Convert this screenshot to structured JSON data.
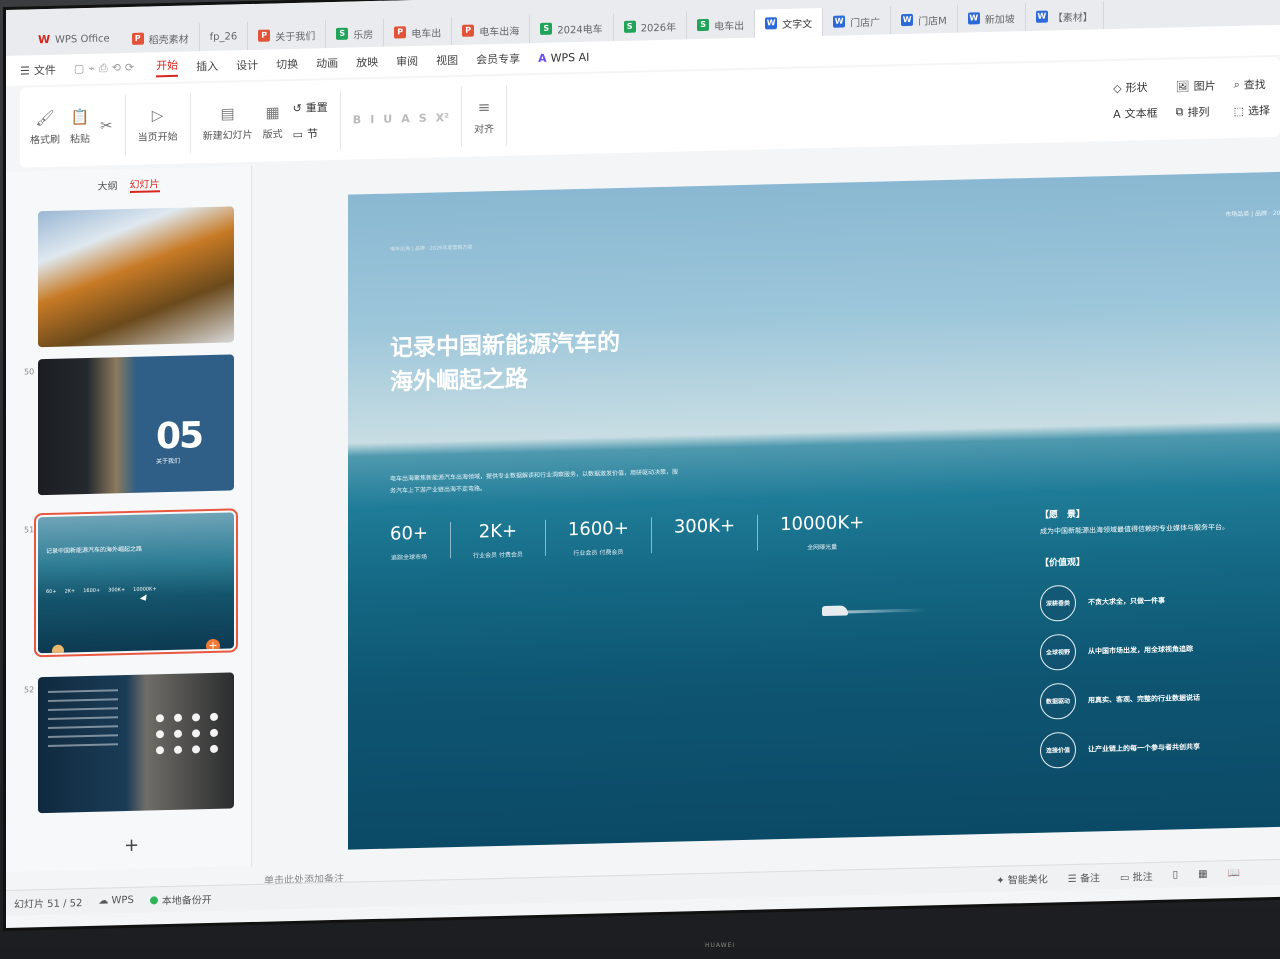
{
  "tabbar": {
    "home": "WPS Office",
    "tabs": [
      {
        "label": "稻壳素材",
        "type": "p"
      },
      {
        "label": "fp_26",
        "type": "none"
      },
      {
        "label": "关于我们",
        "type": "p"
      },
      {
        "label": "乐房",
        "type": "s"
      },
      {
        "label": "电车出",
        "type": "p"
      },
      {
        "label": "电车出海",
        "type": "p"
      },
      {
        "label": "2024电车",
        "type": "s"
      },
      {
        "label": "2026年",
        "type": "s"
      },
      {
        "label": "电车出",
        "type": "s"
      },
      {
        "label": "文字文",
        "type": "w"
      },
      {
        "label": "门店广",
        "type": "w"
      },
      {
        "label": "门店M",
        "type": "w"
      },
      {
        "label": "新加坡",
        "type": "w"
      },
      {
        "label": "【素材】",
        "type": "w"
      }
    ]
  },
  "menubar": {
    "file": "文件",
    "items": [
      "开始",
      "插入",
      "设计",
      "切换",
      "动画",
      "放映",
      "审阅",
      "视图",
      "会员专享"
    ],
    "ai": "WPS AI"
  },
  "ribbon": {
    "format_painter": "格式刷",
    "paste": "粘贴",
    "play_from_current": "当页开始",
    "new_slide": "新建幻灯片",
    "layout": "版式",
    "reset": "重置",
    "section": "节",
    "align": "对齐",
    "shape": "形状",
    "picture": "图片",
    "textbox": "文本框",
    "arrange": "排列",
    "find": "查找",
    "select": "选择"
  },
  "leftpanel": {
    "tab_outline": "大纲",
    "tab_slides": "幻灯片",
    "thumb_numbers": [
      "50",
      "51",
      "52"
    ],
    "thumb2_big": "05",
    "thumb2_caption": "关于我们",
    "thumb3_title": "记录中国新能源汽车的海外崛起之路",
    "thumb3_stats": [
      "60+",
      "2K+",
      "1600+",
      "300K+",
      "10000K+"
    ]
  },
  "slide": {
    "breadcrumb": "电车出海 | 品牌 · 2026年度营销方案",
    "top_right": "市场品类 | 品牌 · 2026",
    "title_line1": "记录中国新能源汽车的",
    "title_line2": "海外崛起之路",
    "description": "电车出海聚焦新能源汽车出海领域，提供专业数据解读和行业洞察服务，以数据激发价值，用研驱动决策，服务汽车上下游产业链出海不走弯路。",
    "stats": [
      {
        "value": "60+",
        "label": "追踪全球市场"
      },
      {
        "value": "2K+",
        "label": "行业会员 付费会员"
      },
      {
        "value": "1600+",
        "label": "行业会员 付费会员"
      },
      {
        "value": "300K+",
        "label": ""
      },
      {
        "value": "10000K+",
        "label": "全网曝光量"
      }
    ],
    "vision_heading": "【愿　景】",
    "vision_text": "成为中国新能源出海领域最值得信赖的专业媒体与服务平台。",
    "values_heading": "【价值观】",
    "values": [
      {
        "badge": "深耕垂类",
        "text": "不贪大求全，只做一件事"
      },
      {
        "badge": "全球视野",
        "text": "从中国市场出发，用全球视角追踪"
      },
      {
        "badge": "数据驱动",
        "text": "用真实、客观、完整的行业数据说话"
      },
      {
        "badge": "连接价值",
        "text": "让产业链上的每一个参与者共创共享"
      }
    ]
  },
  "notes_placeholder": "单击此处添加备注",
  "status": {
    "slide_count": "幻灯片 51 / 52",
    "wps": "WPS",
    "backup": "本地备份开",
    "beautify": "智能美化",
    "notes": "备注",
    "comments": "批注"
  },
  "bezel": "HUAWEI"
}
